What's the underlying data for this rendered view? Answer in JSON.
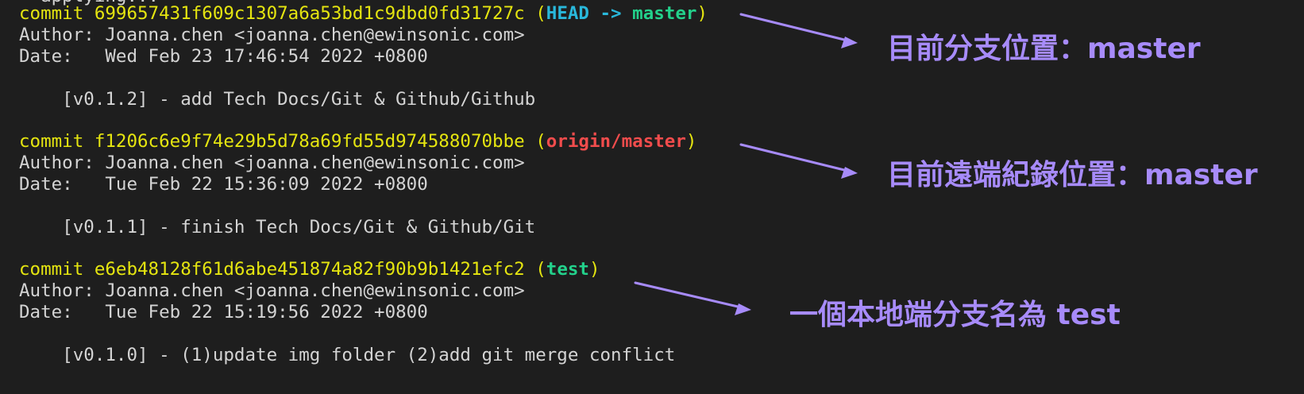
{
  "partial_top_line": "  applying...",
  "commits": [
    {
      "commit_label": "commit",
      "hash": "699657431f609c1307a6a53bd1c9dbd0fd31727c",
      "refs": {
        "open": "(",
        "head": "HEAD",
        "arrow": "->",
        "branch": "master",
        "close": ")"
      },
      "author_label": "Author:",
      "author": "Joanna.chen <joanna.chen@ewinsonic.com>",
      "date_label": "Date:",
      "date": "Wed Feb 23 17:46:54 2022 +0800",
      "message": "[v0.1.2] - add Tech Docs/Git & Github/Github"
    },
    {
      "commit_label": "commit",
      "hash": "f1206c6e9f74e29b5d78a69fd55d974588070bbe",
      "refs": {
        "open": "(",
        "remote": "origin/master",
        "close": ")"
      },
      "author_label": "Author:",
      "author": "Joanna.chen <joanna.chen@ewinsonic.com>",
      "date_label": "Date:",
      "date": "Tue Feb 22 15:36:09 2022 +0800",
      "message": "[v0.1.1] - finish Tech Docs/Git & Github/Git"
    },
    {
      "commit_label": "commit",
      "hash": "e6eb48128f61d6abe451874a82f90b9b1421efc2",
      "refs": {
        "open": "(",
        "branch": "test",
        "close": ")"
      },
      "author_label": "Author:",
      "author": "Joanna.chen <joanna.chen@ewinsonic.com>",
      "date_label": "Date:",
      "date": "Tue Feb 22 15:19:56 2022 +0800",
      "message": "[v0.1.0] - (1)update img folder (2)add git merge conflict"
    }
  ],
  "annotations": {
    "head": "目前分支位置：master",
    "remote": "目前遠端紀錄位置：master",
    "local": "一個本地端分支名為 test"
  },
  "colors": {
    "background": "#1e1e1e",
    "text": "#d4d4d4",
    "hash": "#e5e510",
    "head": "#29b8db",
    "branch": "#23d18b",
    "remote": "#f14c4c",
    "annotation": "#a78bfa"
  }
}
